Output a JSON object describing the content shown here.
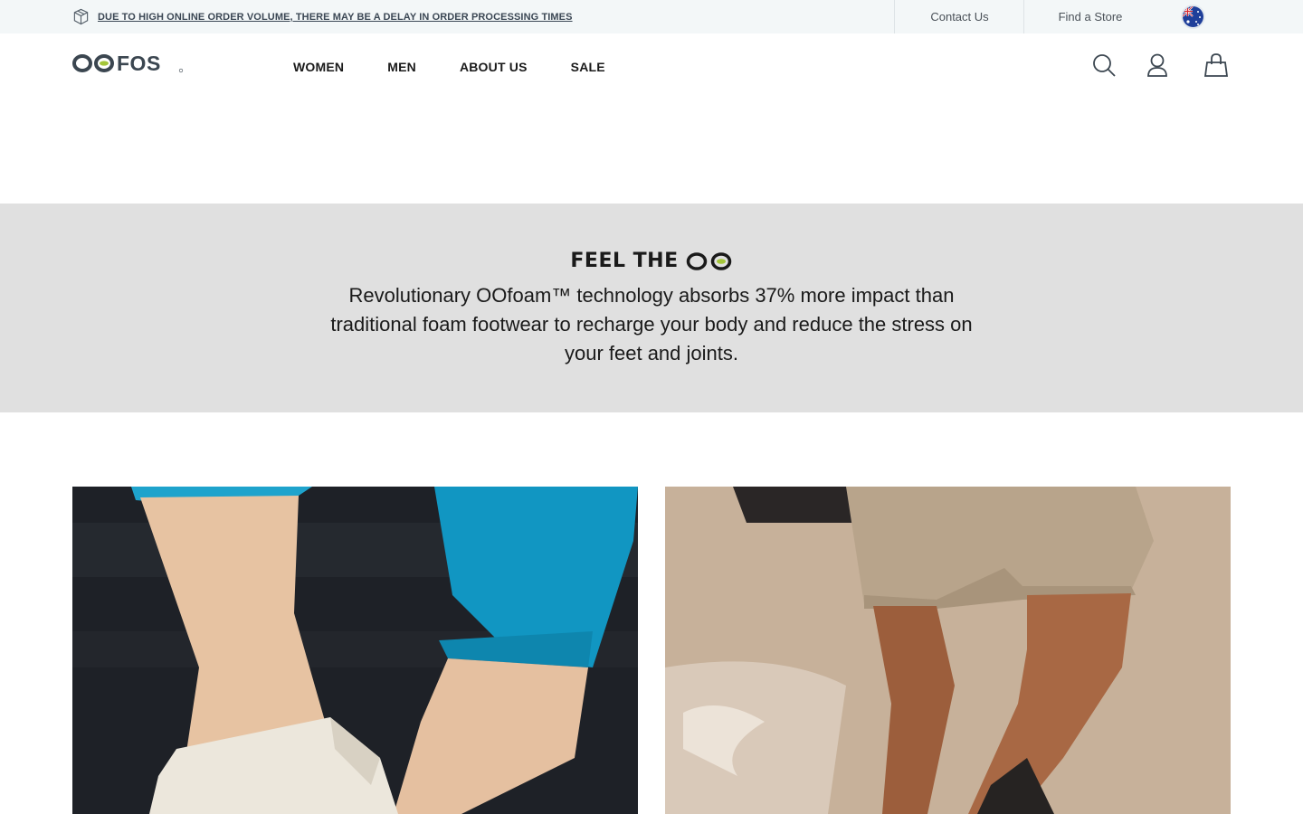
{
  "announcement": {
    "icon": "package-icon",
    "text": "DUE TO HIGH ONLINE ORDER VOLUME, THERE MAY BE A DELAY IN ORDER PROCESSING TIMES"
  },
  "utility_links": {
    "contact": "Contact Us",
    "store": "Find a Store",
    "region_flag": "australia-flag-icon"
  },
  "header": {
    "logo": "OOFOS",
    "nav": [
      "WOMEN",
      "MEN",
      "ABOUT US",
      "SALE"
    ],
    "icons": [
      "search-icon",
      "account-icon",
      "bag-icon"
    ]
  },
  "feel": {
    "title": "FEEL THE",
    "title_logo": "OO",
    "body": "Revolutionary OOfoam™ technology absorbs 37% more impact than traditional foam footwear to recharge your body and reduce the stress on your feet and joints."
  },
  "colors": {
    "announcement_bg": "#f3f7f8",
    "banner_bg": "#e0e0e0",
    "brand_green": "#a4c639",
    "text_dark": "#1a1a1a"
  }
}
